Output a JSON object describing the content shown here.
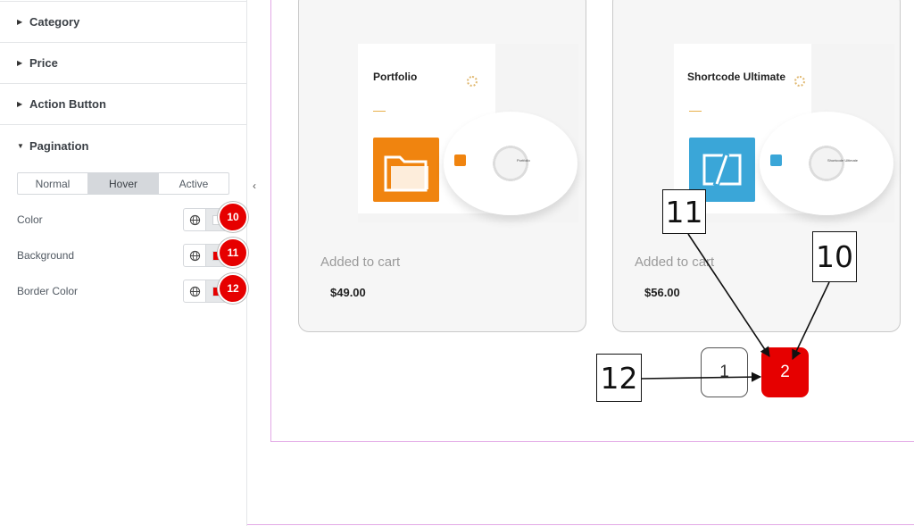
{
  "panel": {
    "sections": [
      {
        "label": "Category",
        "expanded": false
      },
      {
        "label": "Price",
        "expanded": false
      },
      {
        "label": "Action Button",
        "expanded": false
      },
      {
        "label": "Pagination",
        "expanded": true
      }
    ],
    "state_tabs": [
      {
        "label": "Normal",
        "active": false
      },
      {
        "label": "Hover",
        "active": true
      },
      {
        "label": "Active",
        "active": false
      }
    ],
    "collapse_icon": "chevron-left-icon",
    "controls": [
      {
        "label": "Color",
        "swatch": "#ffffff",
        "badge": "10"
      },
      {
        "label": "Background",
        "swatch": "#e60000",
        "badge": "11"
      },
      {
        "label": "Border Color",
        "swatch": "#e60000",
        "badge": "12"
      }
    ]
  },
  "products": [
    {
      "title": "Portfolio",
      "status": "Added to cart",
      "price": "$49.00",
      "accent": "#f0840f",
      "disc_label": "Portfolio"
    },
    {
      "title": "Shortcode Ultimate",
      "status": "Added to cart",
      "price": "$56.00",
      "accent": "#3aa6d8",
      "disc_label": "Shortcode Ultimate"
    }
  ],
  "pagination": {
    "pages": [
      "1",
      "2"
    ],
    "current": "2"
  },
  "callouts": [
    "10",
    "11",
    "12"
  ],
  "colors": {
    "accent_red": "#e60000",
    "frame_border": "#e3a8e6"
  }
}
